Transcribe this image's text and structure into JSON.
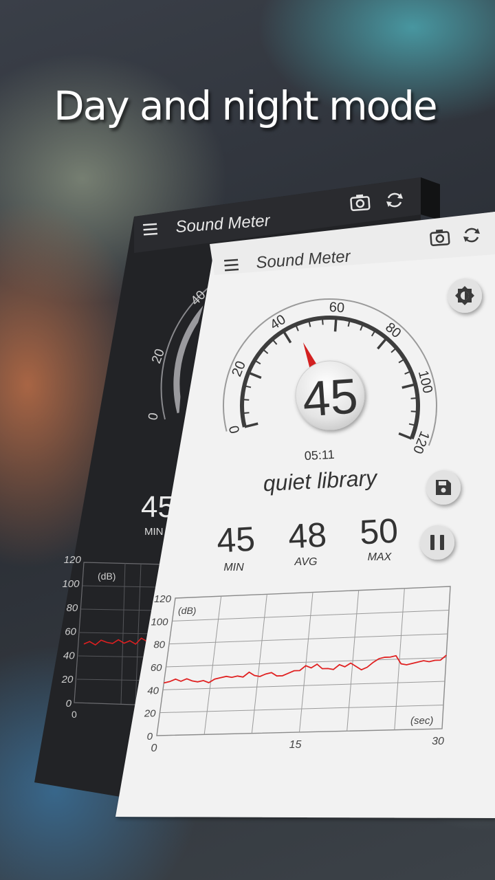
{
  "headline": "Day and night mode",
  "app": {
    "title": "Sound Meter"
  },
  "gauge": {
    "ticks": [
      "0",
      "20",
      "40",
      "60",
      "80",
      "100",
      "120"
    ],
    "value": "45",
    "time": "05:11",
    "status": "quiet library"
  },
  "stats": {
    "min_value": "45",
    "min_label": "MIN",
    "avg_value": "48",
    "avg_label": "AVG",
    "max_value": "50",
    "max_label": "MAX"
  },
  "chart_data": {
    "type": "line",
    "title": "",
    "ylabel": "(dB)",
    "xlabel": "(sec)",
    "ylim": [
      0,
      120
    ],
    "xlim": [
      0,
      30
    ],
    "yticks": [
      "0",
      "20",
      "40",
      "60",
      "80",
      "100",
      "120"
    ],
    "xticks": [
      "0",
      "15",
      "30"
    ],
    "grid": true,
    "series": [
      {
        "color": "#e02020",
        "x": [
          0,
          0.6,
          1.2,
          1.8,
          2.4,
          3,
          3.6,
          4.2,
          4.8,
          5.4,
          6,
          6.6,
          7.2,
          7.8,
          8.4,
          9,
          9.6,
          10.2,
          10.8,
          11.4,
          12,
          12.6,
          13.2,
          13.8,
          14.4,
          15,
          15.6,
          16.2,
          16.8,
          17.4,
          18,
          18.6,
          19.2,
          19.8,
          20.4,
          21,
          21.6,
          22.2,
          22.8,
          23.4,
          24,
          24.6,
          25.2,
          25.8,
          26.4,
          27,
          27.6,
          28.2,
          28.8,
          29.4,
          30
        ],
        "y": [
          46,
          47,
          49,
          47,
          49,
          47,
          46,
          47,
          45,
          48,
          49,
          50,
          49,
          50,
          49,
          53,
          50,
          49,
          51,
          52,
          49,
          49,
          51,
          53,
          53,
          57,
          55,
          58,
          54,
          54,
          53,
          57,
          55,
          58,
          55,
          52,
          54,
          58,
          61,
          62,
          62,
          63,
          56,
          55,
          56,
          57,
          58,
          57,
          58,
          58,
          62
        ]
      }
    ]
  },
  "dark_chart": {
    "yticks": [
      "0",
      "20",
      "40",
      "60",
      "80",
      "100",
      "120"
    ],
    "ylabel": "(dB)",
    "xtick0": "0",
    "y": [
      50,
      52,
      49,
      53,
      51,
      50,
      53,
      50,
      52,
      49,
      54,
      51
    ]
  },
  "colors": {
    "accent": "#d32020",
    "dark_bg": "#222326",
    "light_bg": "#f2f2f2"
  }
}
